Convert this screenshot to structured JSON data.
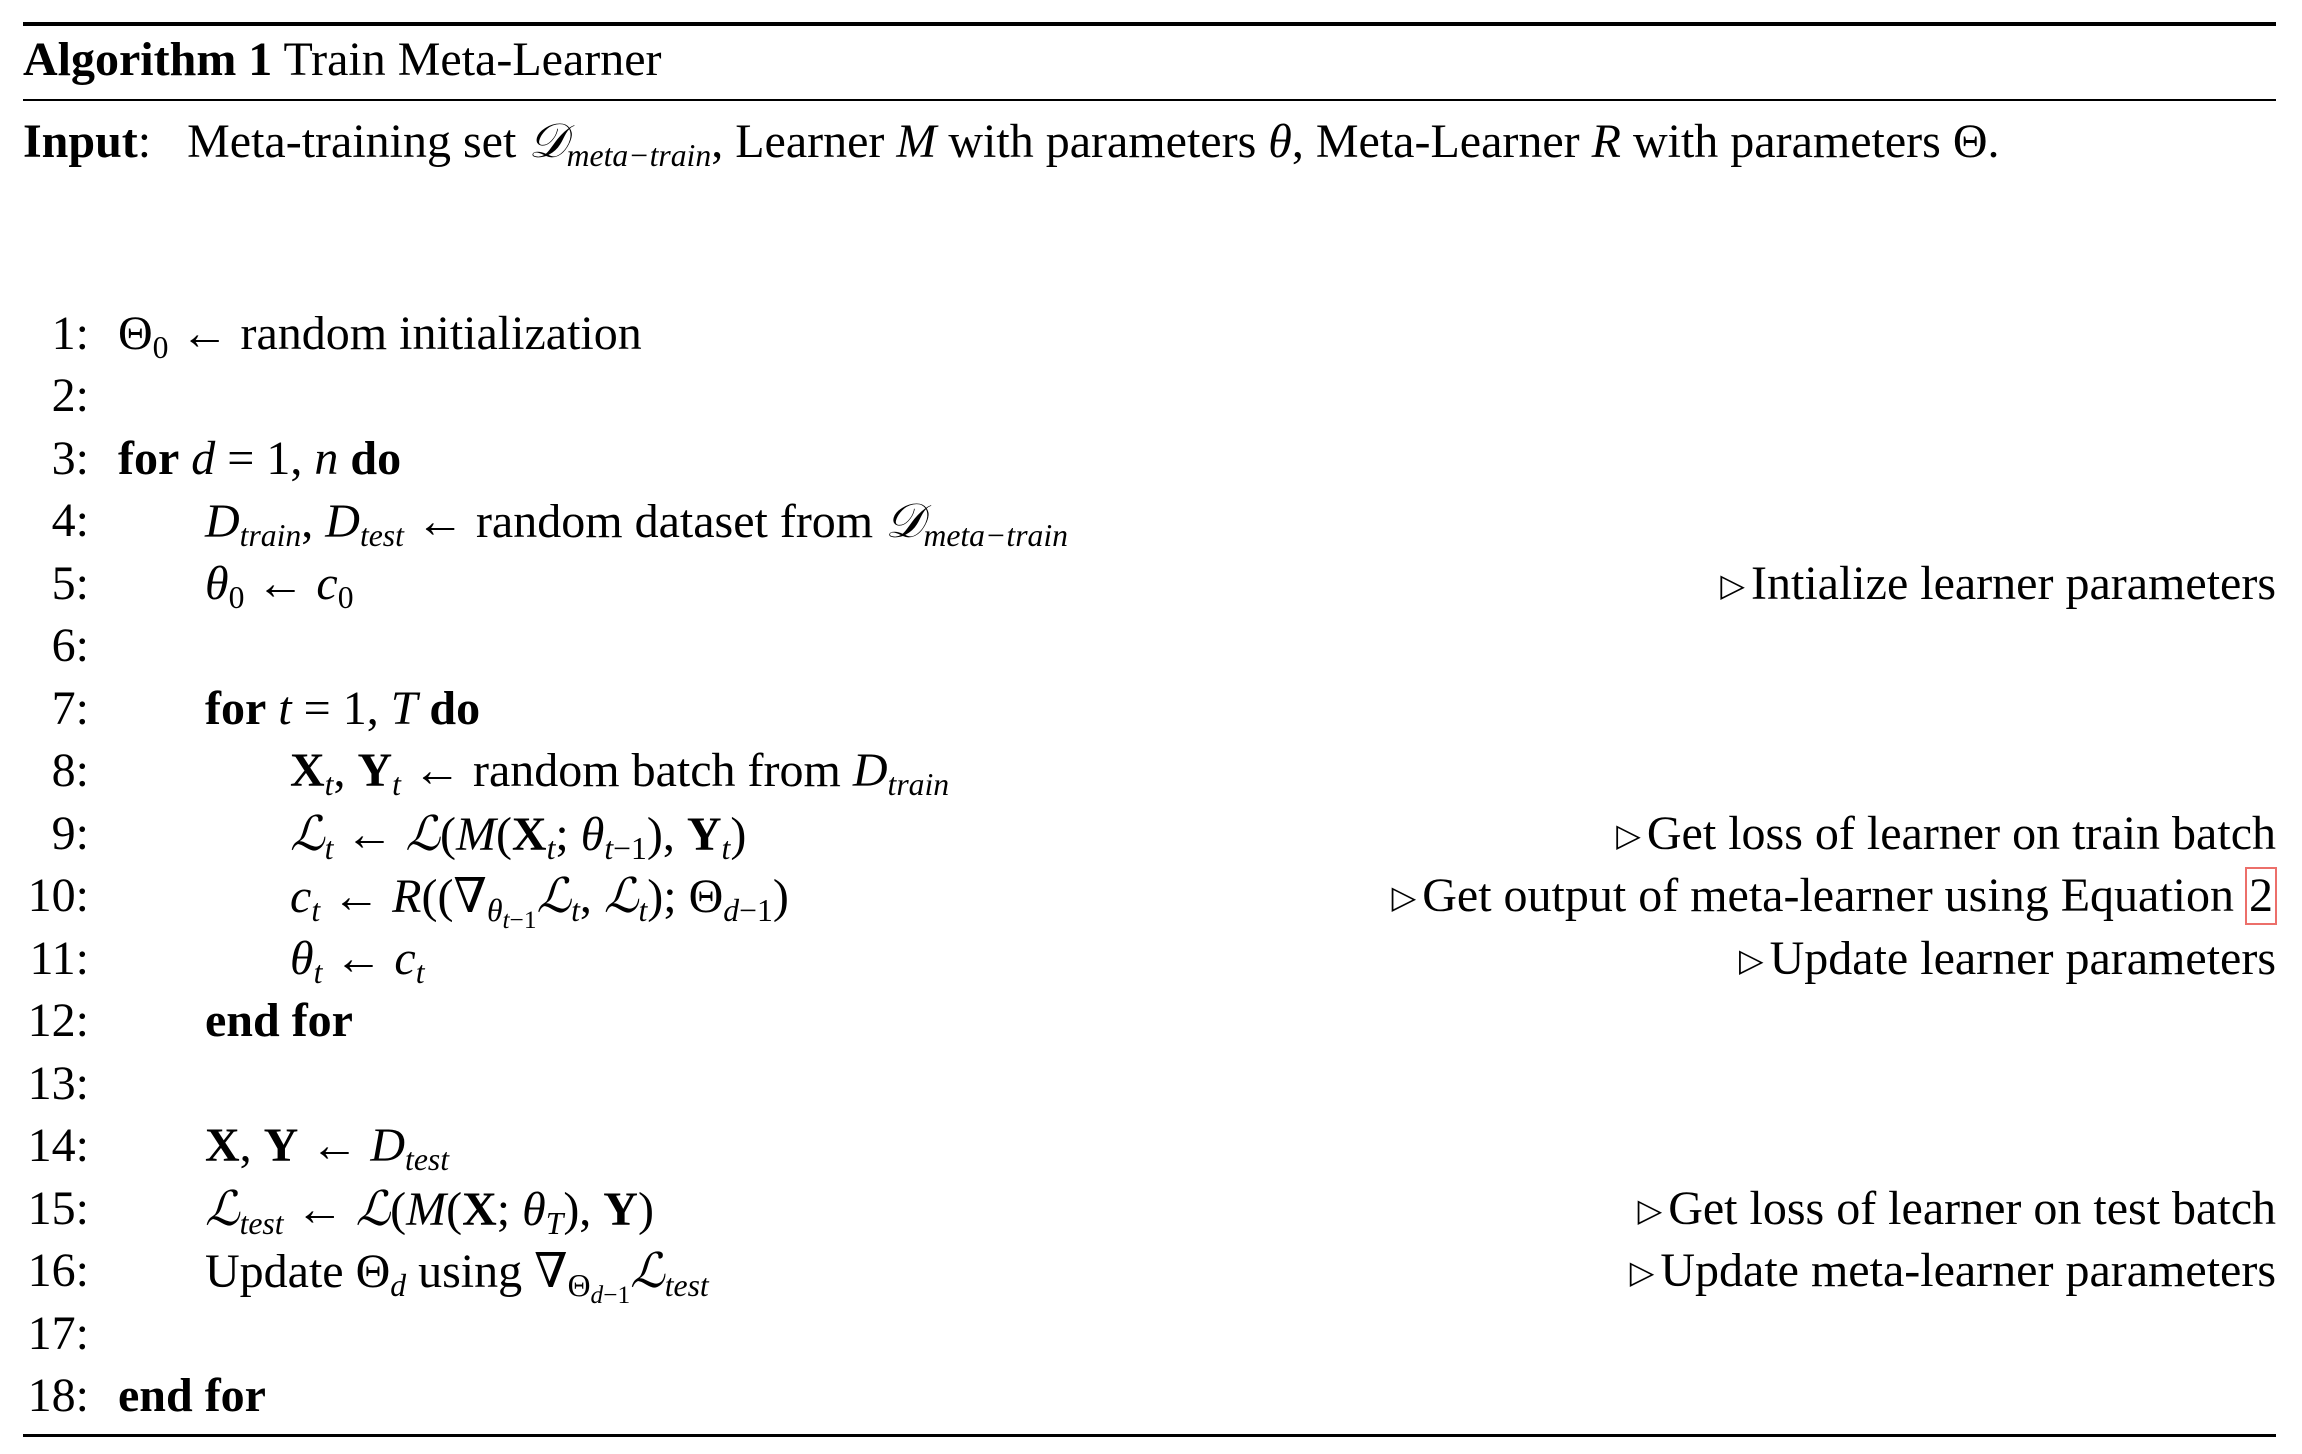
{
  "algorithm": {
    "label": "Algorithm 1",
    "title": "Train Meta-Learner"
  },
  "input": {
    "label": "Input",
    "text_1": "Meta-training set",
    "set_symbol": "𝒟",
    "set_sub": "meta−train",
    "text_2": ", Learner",
    "learner_symbol": "M",
    "text_3": "with parameters",
    "learner_params": "θ",
    "text_4": ", Meta-Learner",
    "meta_symbol": "R",
    "text_5": "with parameters",
    "meta_params": "Θ",
    "end": "."
  },
  "lines": [
    {
      "num": "1:",
      "comment": ""
    },
    {
      "num": "2:",
      "comment": ""
    },
    {
      "num": "3:",
      "comment": ""
    },
    {
      "num": "4:",
      "comment": ""
    },
    {
      "num": "5:",
      "comment": "Intialize learner parameters"
    },
    {
      "num": "6:",
      "comment": ""
    },
    {
      "num": "7:",
      "comment": ""
    },
    {
      "num": "8:",
      "comment": ""
    },
    {
      "num": "9:",
      "comment": "Get loss of learner on train batch"
    },
    {
      "num": "10:",
      "comment": "Get output of meta-learner using Equation"
    },
    {
      "num": "11:",
      "comment": "Update learner parameters"
    },
    {
      "num": "12:",
      "comment": ""
    },
    {
      "num": "13:",
      "comment": ""
    },
    {
      "num": "14:",
      "comment": ""
    },
    {
      "num": "15:",
      "comment": "Get loss of learner on test batch"
    },
    {
      "num": "16:",
      "comment": "Update meta-learner parameters"
    },
    {
      "num": "17:",
      "comment": ""
    },
    {
      "num": "18:",
      "comment": ""
    }
  ],
  "text": {
    "random_initialization": "random initialization",
    "for": "for",
    "do": "do",
    "end_for": "end for",
    "random_dataset_from": "random dataset from",
    "random_batch_from": "random batch from",
    "update": "Update",
    "using": "using",
    "arrow": "←",
    "comment_marker": "▷"
  },
  "equation_ref": "2",
  "colors": {
    "link_box": "#ec6f6a",
    "text": "#000000",
    "background": "#ffffff"
  }
}
